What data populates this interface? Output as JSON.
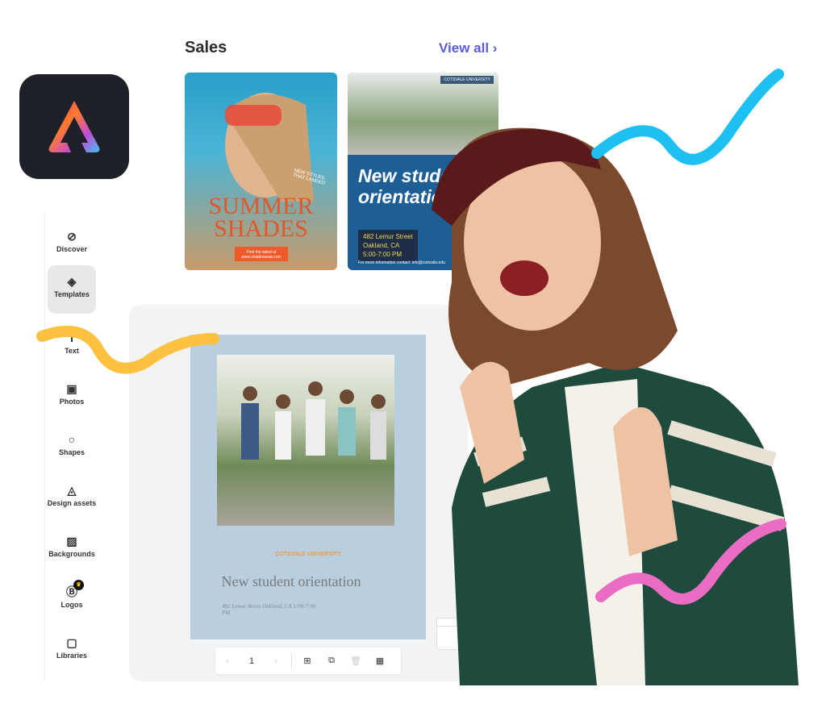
{
  "app": {
    "name": "Adobe Express",
    "logo_icon": "adobe-express-logo"
  },
  "sales": {
    "title": "Sales",
    "view_all": "View all",
    "view_all_icon": "chevron-right-icon",
    "accent_color": "#5b5bdc",
    "cards": [
      {
        "title": "SUMMER SHADES",
        "tagline": "NEW STYLES THAT LANDED",
        "button": "Find the latest at www.shadeswear.com"
      },
      {
        "title": "New student orientation",
        "badge": "COTSVALE UNIVERSITY",
        "address": "482 Lemur Street\nOakland, CA\n5:00-7:00 PM",
        "footer": "For more information contact: info@cotsvale.edu"
      }
    ]
  },
  "sidebar": {
    "items": [
      {
        "label": "Discover",
        "icon": "compass-icon"
      },
      {
        "label": "Templates",
        "icon": "templates-icon",
        "active": true
      },
      {
        "label": "Text",
        "icon": "text-icon"
      },
      {
        "label": "Photos",
        "icon": "image-icon"
      },
      {
        "label": "Shapes",
        "icon": "shape-icon"
      },
      {
        "label": "Design assets",
        "icon": "design-assets-icon"
      },
      {
        "label": "Backgrounds",
        "icon": "backgrounds-icon"
      },
      {
        "label": "Logos",
        "icon": "logo-icon",
        "premium": true
      },
      {
        "label": "Libraries",
        "icon": "library-icon"
      }
    ]
  },
  "canvas": {
    "page": {
      "university": "COTSVALE UNIVERSITY",
      "title": "New student orientation",
      "address": "482 Lemur Street Oakland, CA 5:00-7:00 PM"
    },
    "toolbar": {
      "page_number": "1",
      "prev_icon": "chevron-left-icon",
      "next_icon": "chevron-right-icon",
      "add_page_icon": "add-page-icon",
      "duplicate_icon": "duplicate-icon",
      "delete_icon": "trash-icon",
      "grid_icon": "grid-icon"
    }
  },
  "decor": {
    "squiggle_colors": [
      "#fcc13f",
      "#1ec0f2",
      "#ea6dc3"
    ]
  }
}
